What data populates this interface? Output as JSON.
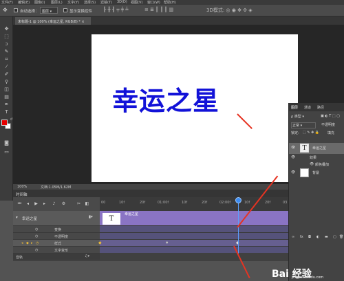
{
  "menubar": {
    "items": [
      "文件(F)",
      "编辑(E)",
      "图像(I)",
      "图层(L)",
      "文字(Y)",
      "选择(S)",
      "滤镜(T)",
      "3D(D)",
      "视图(V)",
      "窗口(W)",
      "帮助(H)"
    ]
  },
  "options": {
    "auto_select": "自动选择：",
    "auto_select_value": "图层",
    "show_transform": "显示变换控件"
  },
  "document": {
    "tab_title": "未标题-1 @ 100% (幸运之星, RGB/8) *",
    "canvas_text": "幸运之星"
  },
  "status": {
    "zoom": "100%",
    "doc_info": "文档:1.05M/1.62M"
  },
  "timeline": {
    "title": "时间轴",
    "ticks": [
      "00",
      "10f",
      "20f",
      "01:00f",
      "10f",
      "20f",
      "02:00f",
      "10f",
      "20f",
      "03"
    ],
    "layer_name": "幸运之星",
    "clip_label": "幸运之星",
    "clip_thumb": "T",
    "tracks": [
      "变换",
      "不透明度",
      "样式",
      "文字变形"
    ],
    "audio": "音轨"
  },
  "layers": {
    "tabs": [
      "图层",
      "通道",
      "路径"
    ],
    "kind": "类型",
    "blend": "正常",
    "opacity_label": "不透明度",
    "lock_label": "锁定:",
    "fill_label": "填充",
    "items": [
      {
        "name": "幸运之星",
        "thumb": "T",
        "selected": true
      },
      {
        "name": "效果",
        "selected": false
      },
      {
        "name": "颜色叠加",
        "selected": false
      },
      {
        "name": "背景",
        "selected": false
      }
    ]
  },
  "watermark": {
    "brand": "Bai 经验",
    "url": "jingyan.baidu.com"
  },
  "colors": {
    "text_blue": "#1212d8",
    "foreground": "#e60000",
    "clip": "#8a74c4",
    "annotation": "#e63322"
  }
}
